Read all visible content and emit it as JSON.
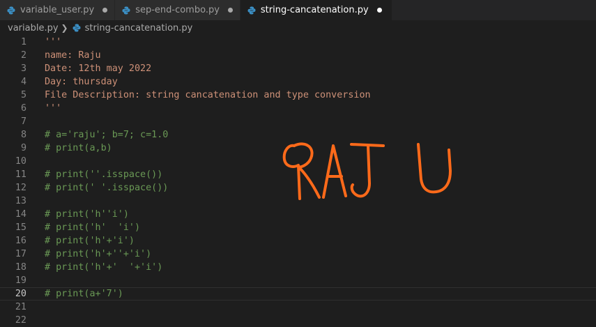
{
  "tabs": [
    {
      "label": "variable_user.py",
      "active": false,
      "modified": true
    },
    {
      "label": "sep-end-combo.py",
      "active": false,
      "modified": true
    },
    {
      "label": "string-cancatenation.py",
      "active": true,
      "modified": true
    }
  ],
  "breadcrumb": {
    "folder": "variable.py",
    "file": "string-cancatenation.py"
  },
  "editor": {
    "current_line": 20,
    "lines": [
      {
        "n": "1",
        "text": "'''",
        "kind": "string"
      },
      {
        "n": "2",
        "text": "name: Raju",
        "kind": "string"
      },
      {
        "n": "3",
        "text": "Date: 12th may 2022",
        "kind": "string"
      },
      {
        "n": "4",
        "text": "Day: thursday",
        "kind": "string"
      },
      {
        "n": "5",
        "text": "File Description: string cancatenation and type conversion",
        "kind": "string"
      },
      {
        "n": "6",
        "text": "'''",
        "kind": "string"
      },
      {
        "n": "7",
        "text": "",
        "kind": "plain"
      },
      {
        "n": "8",
        "text": "# a='raju'; b=7; c=1.0",
        "kind": "comment"
      },
      {
        "n": "9",
        "text": "# print(a,b)",
        "kind": "comment"
      },
      {
        "n": "10",
        "text": "",
        "kind": "plain"
      },
      {
        "n": "11",
        "text": "# print(''.isspace())",
        "kind": "comment"
      },
      {
        "n": "12",
        "text": "# print(' '.isspace())",
        "kind": "comment"
      },
      {
        "n": "13",
        "text": "",
        "kind": "plain"
      },
      {
        "n": "14",
        "text": "# print('h''i')",
        "kind": "comment"
      },
      {
        "n": "15",
        "text": "# print('h'  'i')",
        "kind": "comment"
      },
      {
        "n": "16",
        "text": "# print('h'+'i')",
        "kind": "comment"
      },
      {
        "n": "17",
        "text": "# print('h'+''+'i')",
        "kind": "comment"
      },
      {
        "n": "18",
        "text": "# print('h'+'  '+'i')",
        "kind": "comment"
      },
      {
        "n": "19",
        "text": "",
        "kind": "plain"
      },
      {
        "n": "20",
        "text": "# print(a+'7')",
        "kind": "comment"
      },
      {
        "n": "21",
        "text": "",
        "kind": "plain"
      },
      {
        "n": "22",
        "text": "",
        "kind": "plain"
      }
    ]
  },
  "annotation": {
    "handwritten_text": "RAJU",
    "color": "#ff6a1a"
  },
  "colors": {
    "background": "#1e1e1e",
    "string": "#ce9178",
    "comment": "#6a9955",
    "python_icon": "#3b8fc4"
  }
}
